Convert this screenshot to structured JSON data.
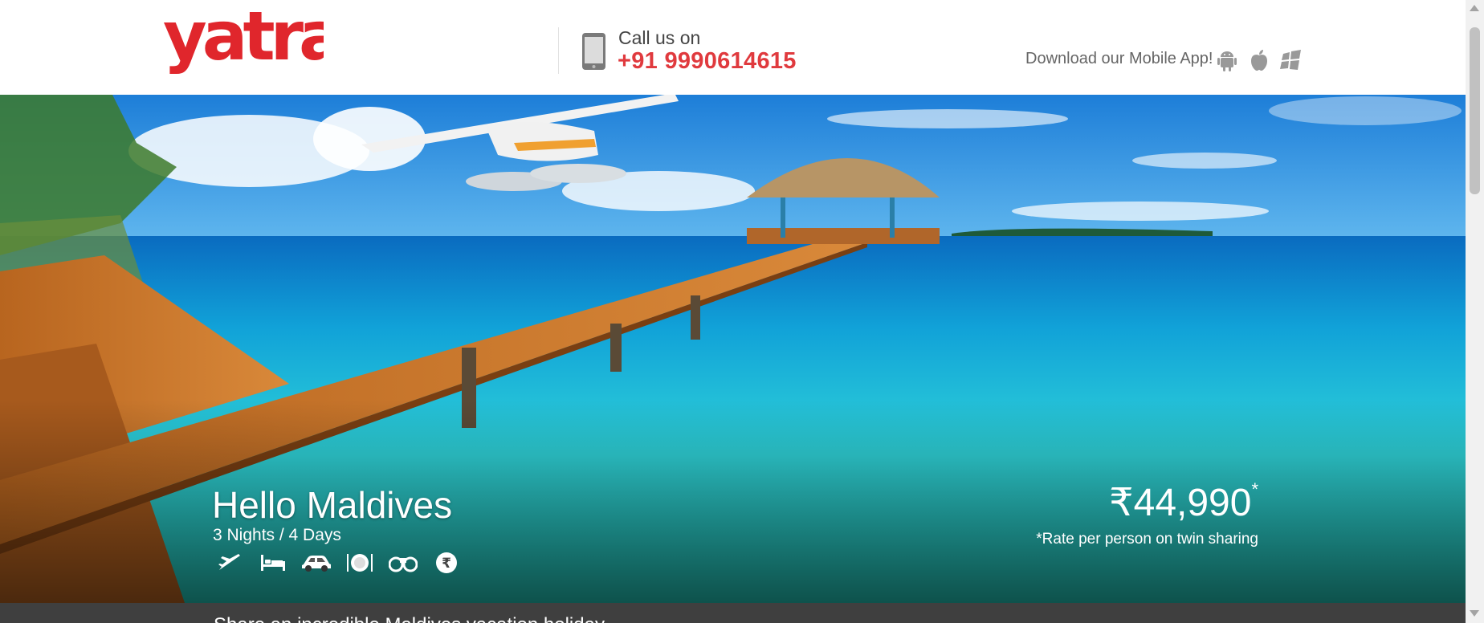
{
  "header": {
    "logo": "yatra",
    "call_label": "Call us on",
    "call_number": "+91 9990614615",
    "app_label": "Download our Mobile App!",
    "app_icons": [
      "android-icon",
      "apple-icon",
      "windows-icon"
    ]
  },
  "hero": {
    "title": "Hello Maldives",
    "duration": "3 Nights / 4 Days",
    "inclusion_icons": [
      "flight-icon",
      "hotel-bed-icon",
      "car-icon",
      "meals-icon",
      "sightseeing-binoculars-icon",
      "rupee-icon"
    ],
    "price": "₹44,990",
    "price_marker": "*",
    "price_note": "*Rate per person on twin sharing"
  },
  "bottom_bar": {
    "text": "Share an incredible Maldives vacation holiday"
  },
  "colors": {
    "brand_red": "#e0262c",
    "phone_red": "#e03a3e",
    "bottom_bar": "#3f3f3f"
  }
}
